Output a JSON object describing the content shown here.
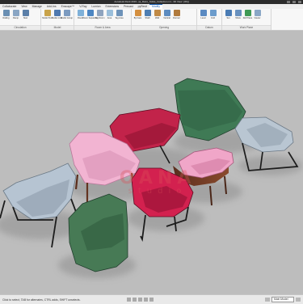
{
  "window": {
    "title": "Autodesk Revit 2019 - [a_Retro_Sofas_Collection.rvt - 3D View: {3D}]"
  },
  "tabs": [
    {
      "label": "Collaborate",
      "active": false
    },
    {
      "label": "View",
      "active": false
    },
    {
      "label": "Manage",
      "active": false
    },
    {
      "label": "Add-Ins",
      "active": false
    },
    {
      "label": "Enscape™",
      "active": false
    },
    {
      "label": "V-Ray",
      "active": false
    },
    {
      "label": "Lumion",
      "active": false
    },
    {
      "label": "Extensions",
      "active": false
    },
    {
      "label": "Precast",
      "active": false
    },
    {
      "label": "pyRevit",
      "active": false
    },
    {
      "label": "Modify",
      "active": true
    }
  ],
  "ribbon": {
    "panels": [
      {
        "title": "Circulation",
        "tools": [
          {
            "label": "Railing",
            "icon": "railing-icon",
            "color": "#6a8fb3"
          },
          {
            "label": "Ramp",
            "icon": "ramp-icon",
            "color": "#8aa6c4"
          },
          {
            "label": "Stair",
            "icon": "stair-icon",
            "color": "#5b7fa8"
          }
        ]
      },
      {
        "title": "Model",
        "tools": [
          {
            "label": "Model Text",
            "icon": "model-text-icon",
            "color": "#c9a34a"
          },
          {
            "label": "Model Line",
            "icon": "model-line-icon",
            "color": "#4f79b0"
          },
          {
            "label": "Model Group",
            "icon": "model-group-icon",
            "color": "#7c9bc0"
          }
        ]
      },
      {
        "title": "Room & Area",
        "tools": [
          {
            "label": "Room",
            "icon": "room-icon",
            "color": "#7fb1d9"
          },
          {
            "label": "Room Separator",
            "icon": "room-separator-icon",
            "color": "#4d86c2"
          },
          {
            "label": "Tag Room",
            "icon": "tag-room-icon",
            "color": "#8fa4bf"
          },
          {
            "label": "Area",
            "icon": "area-icon",
            "color": "#9bbfdb"
          },
          {
            "label": "Tag Area",
            "icon": "tag-area-icon",
            "color": "#6e93b9"
          }
        ]
      },
      {
        "title": "Opening",
        "tools": [
          {
            "label": "By Face",
            "icon": "by-face-icon",
            "color": "#d48f3f"
          },
          {
            "label": "Shaft",
            "icon": "shaft-icon",
            "color": "#4f7fb3"
          },
          {
            "label": "Wall",
            "icon": "wall-opening-icon",
            "color": "#c08a46"
          },
          {
            "label": "Vertical",
            "icon": "vertical-opening-icon",
            "color": "#5d8cc0"
          },
          {
            "label": "Dormer",
            "icon": "dormer-icon",
            "color": "#b07a3d"
          }
        ]
      },
      {
        "title": "Datum",
        "tools": [
          {
            "label": "Level",
            "icon": "level-icon",
            "color": "#5a8ac2"
          },
          {
            "label": "Grid",
            "icon": "grid-icon",
            "color": "#6c9ccc"
          }
        ]
      },
      {
        "title": "Work Plane",
        "tools": [
          {
            "label": "Set",
            "icon": "set-icon",
            "color": "#4a7cb4"
          },
          {
            "label": "Show",
            "icon": "show-icon",
            "color": "#6891bf"
          },
          {
            "label": "Ref Plane",
            "icon": "ref-plane-icon",
            "color": "#3f9a55"
          },
          {
            "label": "Viewer",
            "icon": "viewer-icon",
            "color": "#8aa7c6"
          }
        ]
      }
    ]
  },
  "viewport": {
    "watermark_line1": "OANA",
    "watermark_line2": "studio"
  },
  "chairs": [
    {
      "name": "chair-dark-green-back",
      "color": "#3f7a55"
    },
    {
      "name": "chair-crimson-center-back",
      "color": "#c2234a"
    },
    {
      "name": "chair-light-grey-right",
      "color": "#b9c6d2"
    },
    {
      "name": "chair-light-pink-left",
      "color": "#f2b4d2"
    },
    {
      "name": "chair-pink-wood-right",
      "color": "#f0a6c8"
    },
    {
      "name": "chair-crimson-front-center",
      "color": "#d3214f"
    },
    {
      "name": "chair-light-blue-left",
      "color": "#b6c4d2"
    },
    {
      "name": "chair-dark-green-front",
      "color": "#477a55"
    }
  ],
  "statusbar": {
    "text": "Click to select, TAB for alternates, CTRL adds, SHIFT unselects.",
    "model": "Main Model"
  }
}
